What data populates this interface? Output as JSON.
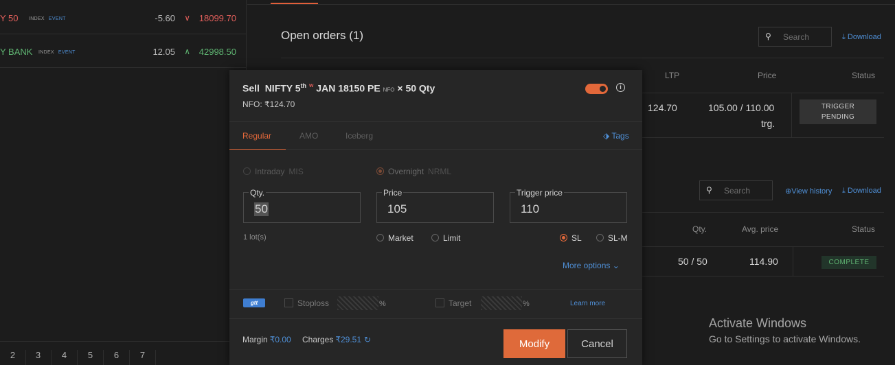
{
  "watchlist": [
    {
      "name": "Y 50",
      "tag1": "INDEX",
      "tag2": "EVENT",
      "change": "-5.60",
      "arrow": "∨",
      "ltp": "18099.70"
    },
    {
      "name": "Y BANK",
      "tag1": "INDEX",
      "tag2": "EVENT",
      "change": "12.05",
      "arrow": "∧",
      "ltp": "42998.50"
    }
  ],
  "pager": [
    "2",
    "3",
    "4",
    "5",
    "6",
    "7"
  ],
  "open_orders": {
    "title": "Open orders (1)",
    "search_placeholder": "Search",
    "download": "Download",
    "headers": {
      "ltp": "LTP",
      "price": "Price",
      "status": "Status"
    },
    "row": {
      "ltp": "124.70",
      "price_line1": "105.00 / 110.00",
      "price_line2": "trg.",
      "status_line1": "TRIGGER",
      "status_line2": "PENDING"
    }
  },
  "executed": {
    "search_placeholder": "Search",
    "view_history": "View history",
    "download": "Download",
    "headers": {
      "qty": "Qty.",
      "avg": "Avg. price",
      "status": "Status"
    },
    "row": {
      "qty": "50 / 50",
      "avg": "114.90",
      "status": "COMPLETE"
    }
  },
  "activate": {
    "line1": "Activate Windows",
    "line2": "Go to Settings to activate Windows."
  },
  "modal": {
    "action": "Sell",
    "instrument": "NIFTY 5",
    "sup": "th",
    "star": "w",
    "instrument_rest": "JAN 18150 PE",
    "exchange_tag": "NFO",
    "qty_text": "× 50 Qty",
    "subtitle": "NFO: ₹124.70",
    "info": "i",
    "tabs": {
      "regular": "Regular",
      "amo": "AMO",
      "iceberg": "Iceberg"
    },
    "tags": "Tags",
    "product": {
      "intraday": "Intraday",
      "mis": "MIS",
      "overnight": "Overnight",
      "nrml": "NRML"
    },
    "fields": {
      "qty_label": "Qty.",
      "qty_value": "50",
      "price_label": "Price",
      "price_value": "105",
      "trigger_label": "Trigger price",
      "trigger_value": "110"
    },
    "lots": "1 lot(s)",
    "order_types": {
      "market": "Market",
      "limit": "Limit",
      "sl": "SL",
      "slm": "SL-M"
    },
    "more_options": "More options",
    "gtt": "gtt",
    "stoploss": "Stoploss",
    "target": "Target",
    "pct": "%",
    "learn_more": "Learn more",
    "margin_label": "Margin",
    "margin_value": "₹0.00",
    "charges_label": "Charges",
    "charges_value": "₹29.51",
    "modify": "Modify",
    "cancel": "Cancel"
  },
  "colors": {
    "accent": "#df6a3a",
    "link": "#4f8fd6",
    "red": "#e25f5b",
    "green": "#5fb572"
  }
}
